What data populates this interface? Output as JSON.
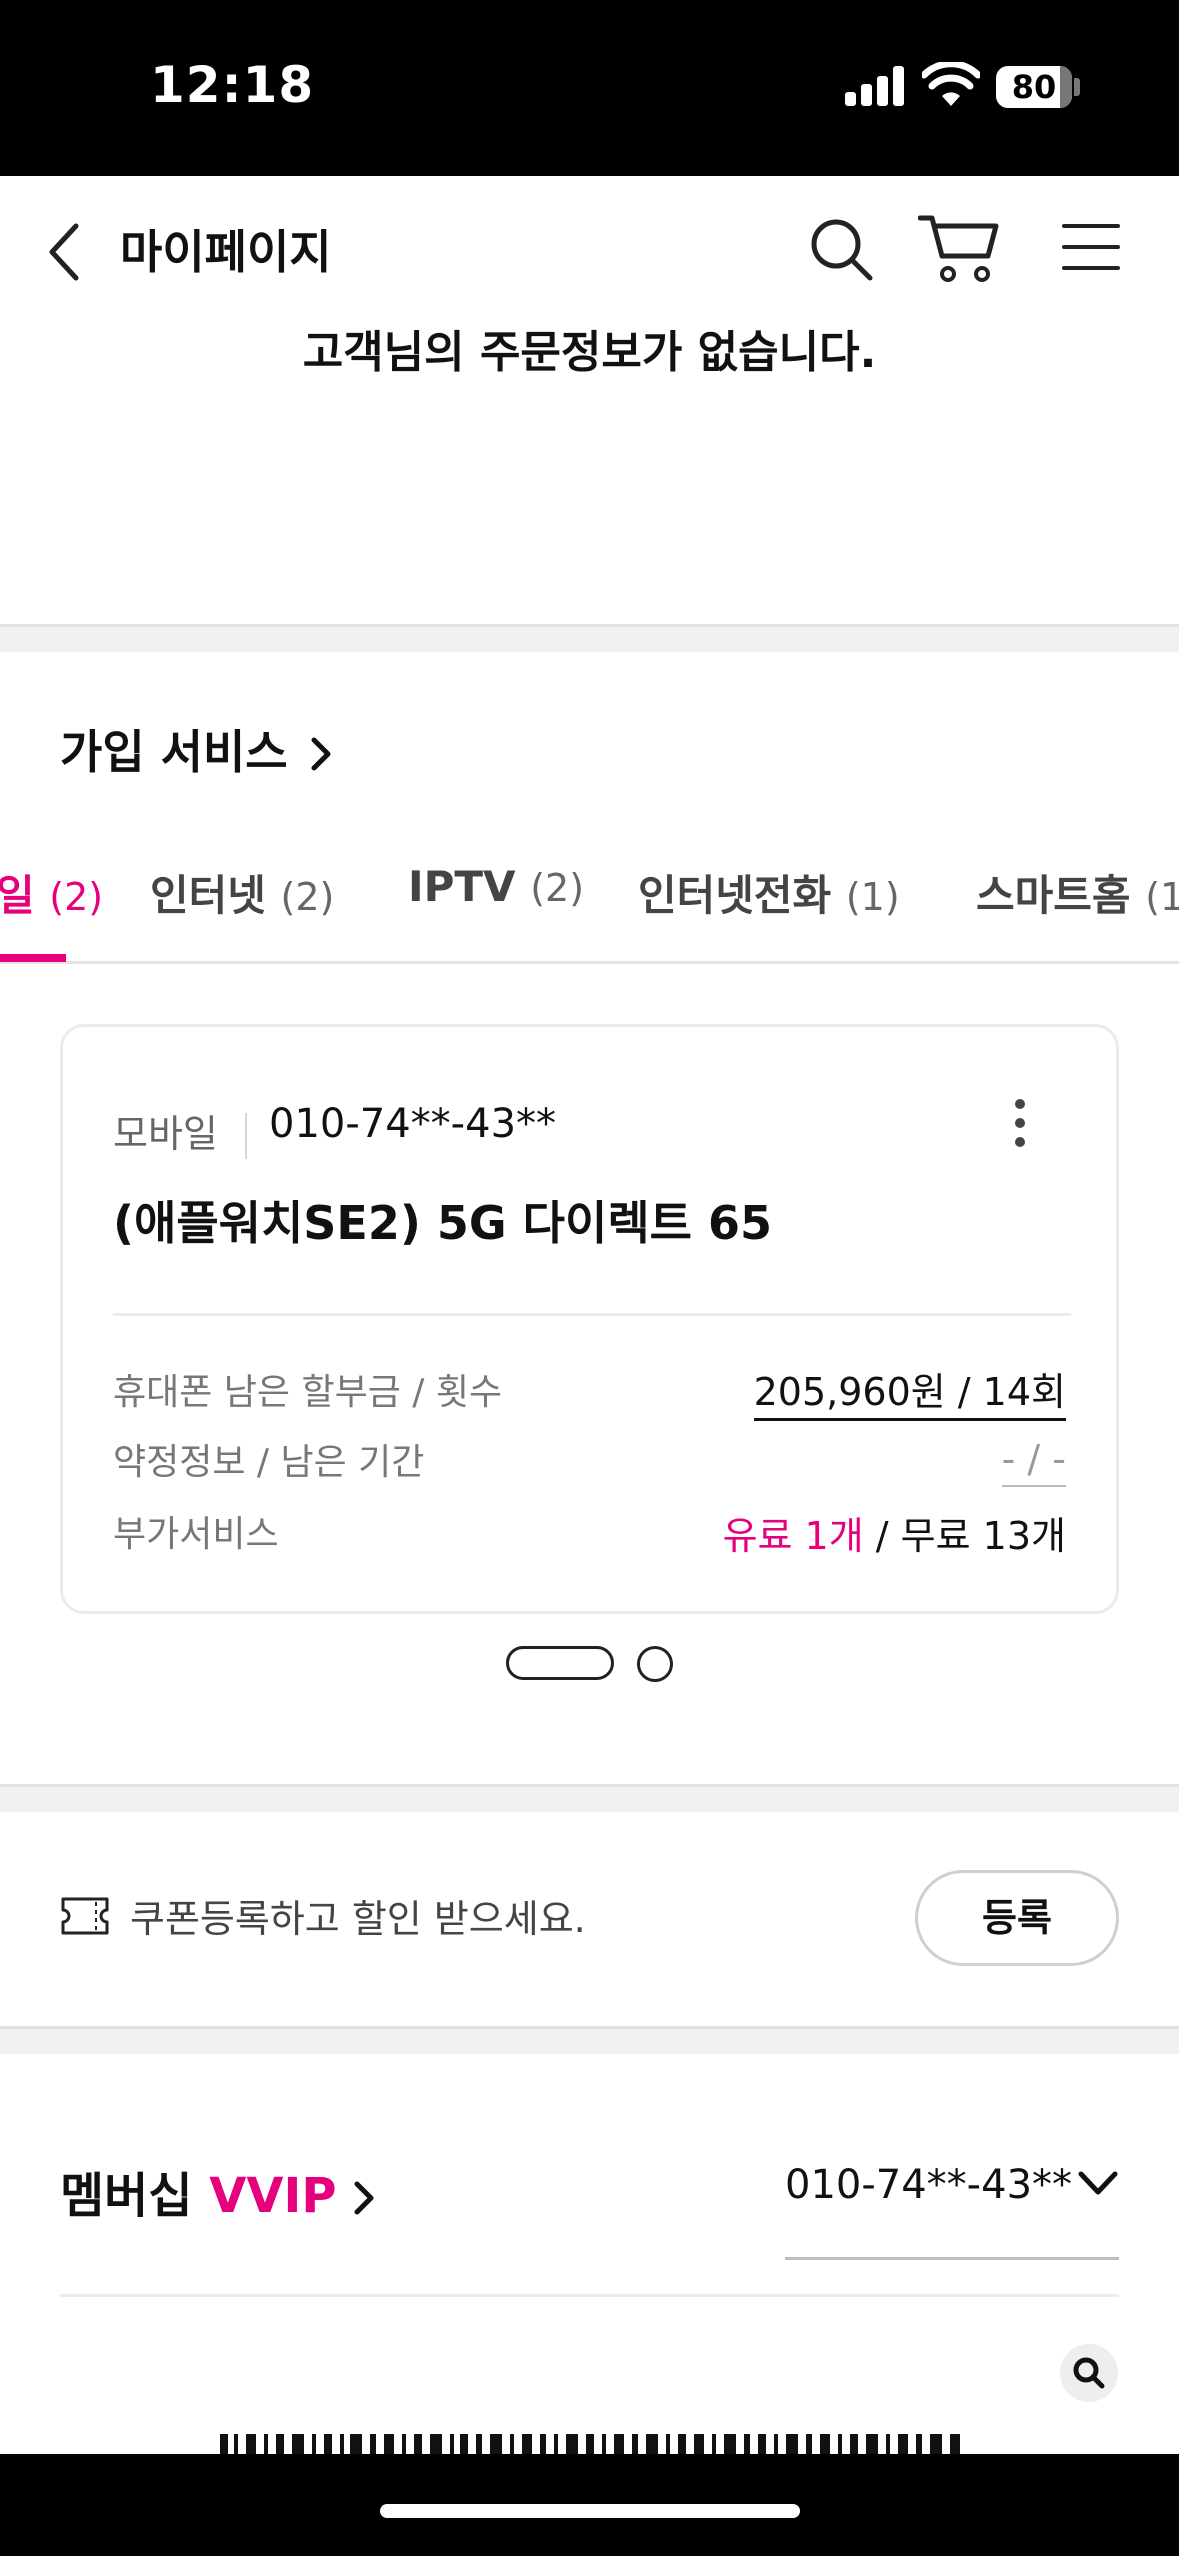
{
  "status_bar": {
    "time": "12:18",
    "battery": "80"
  },
  "header": {
    "title": "마이페이지"
  },
  "order": {
    "empty_message": "고객님의 주문정보가 없습니다."
  },
  "subscription": {
    "title": "가입 서비스",
    "tabs": [
      {
        "label": "일",
        "count": "(2)",
        "active": true
      },
      {
        "label": "인터넷",
        "count": "(2)"
      },
      {
        "label": "IPTV",
        "count": "(2)"
      },
      {
        "label": "인터넷전화",
        "count": "(1)"
      },
      {
        "label": "스마트홈",
        "count": "(1"
      }
    ],
    "card": {
      "type": "모바일",
      "number": "010-74**-43**",
      "plan": "(애플워치SE2) 5G 다이렉트 65",
      "rows": [
        {
          "label": "휴대폰 남은 할부금 / 횟수",
          "value": "205,960원 / 14회"
        },
        {
          "label": "약정정보 / 남은 기간",
          "value": "- / -"
        },
        {
          "label": "부가서비스",
          "paid": "유료 1개",
          "sep": " / ",
          "free": "무료 13개"
        }
      ]
    },
    "pager": {
      "current": 1,
      "total": 2
    }
  },
  "coupon": {
    "text": "쿠폰등록하고 할인 받으세요.",
    "button": "등록"
  },
  "membership": {
    "label": "멤버십",
    "grade": "VVIP",
    "number": "010-74**-43**"
  },
  "colors": {
    "accent": "#e6007e",
    "text": "#111111",
    "muted": "#777777"
  }
}
